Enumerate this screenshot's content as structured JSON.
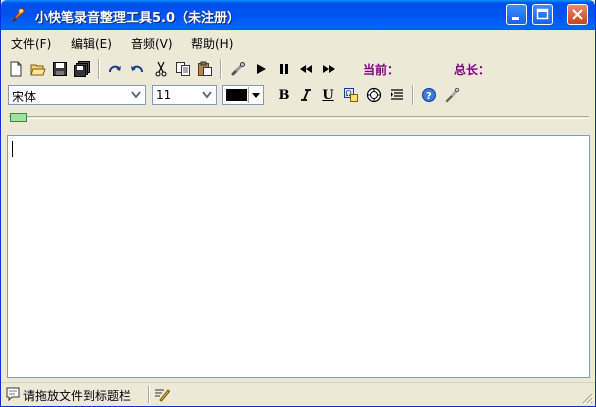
{
  "window": {
    "title": "小快笔录音整理工具5.0（未注册）"
  },
  "menu": [
    {
      "label": "文件(F)"
    },
    {
      "label": "编辑(E)"
    },
    {
      "label": "音频(V)"
    },
    {
      "label": "帮助(H)"
    }
  ],
  "toolbar": {
    "current_label": "当前：",
    "total_label": "总长："
  },
  "format": {
    "font_family": "宋体",
    "font_size": "11",
    "font_color": "#000000",
    "bold": "B",
    "underline": "U"
  },
  "editor": {
    "content": ""
  },
  "statusbar": {
    "hint": "请拖放文件到标题栏"
  },
  "colors": {
    "title_bar": "#0055ea",
    "accent_label": "#800080",
    "progress_thumb": "#a0e0a0"
  },
  "icons": [
    "new-file-icon",
    "open-folder-icon",
    "save-icon",
    "save-all-icon",
    "redo-icon",
    "undo-icon",
    "cut-icon",
    "copy-icon",
    "paste-icon",
    "link-icon",
    "play-icon",
    "pause-icon",
    "rewind-icon",
    "fast-forward-icon",
    "bold-icon",
    "italic-icon",
    "underline-icon",
    "special-char-icon",
    "wheel-icon",
    "paragraph-icon",
    "help-icon",
    "tool-icon"
  ]
}
